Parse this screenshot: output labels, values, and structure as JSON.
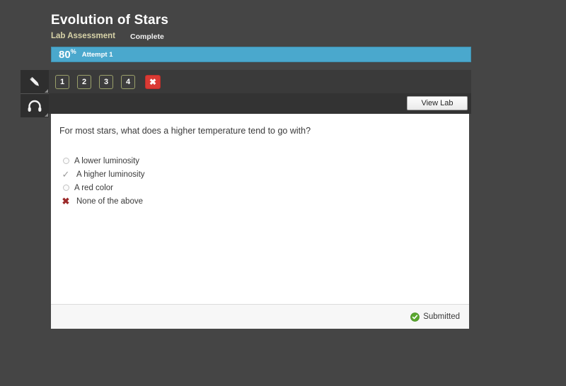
{
  "header": {
    "course_title": "Evolution of Stars",
    "assessment_type": "Lab Assessment",
    "assessment_status": "Complete"
  },
  "progress": {
    "score": "80",
    "score_unit": "%",
    "attempt_label": "Attempt 1",
    "percent": 80,
    "bar_color": "#4aa8cd"
  },
  "tool_rail": {
    "items": [
      {
        "icon": "pencil-icon",
        "name": "annotate-tool"
      },
      {
        "icon": "headphones-icon",
        "name": "audio-tool"
      }
    ]
  },
  "question_nav": {
    "numbers": [
      "1",
      "2",
      "3",
      "4"
    ],
    "close_label": "✖",
    "close_color": "#da3a34",
    "button_border_color": "#9aa06a"
  },
  "lab_toolbar": {
    "view_lab_label": "View Lab"
  },
  "question": {
    "text": "For most stars, what does a higher temperature tend to go with?",
    "options": [
      {
        "label": "A lower luminosity",
        "marker": "radio-empty"
      },
      {
        "label": "A higher luminosity",
        "marker": "check"
      },
      {
        "label": "A red color",
        "marker": "radio-empty"
      },
      {
        "label": "None of the above",
        "marker": "cross"
      }
    ]
  },
  "footer": {
    "status_label": "Submitted",
    "status_icon": "green-check-circle-icon",
    "status_color": "#5aa82f"
  }
}
